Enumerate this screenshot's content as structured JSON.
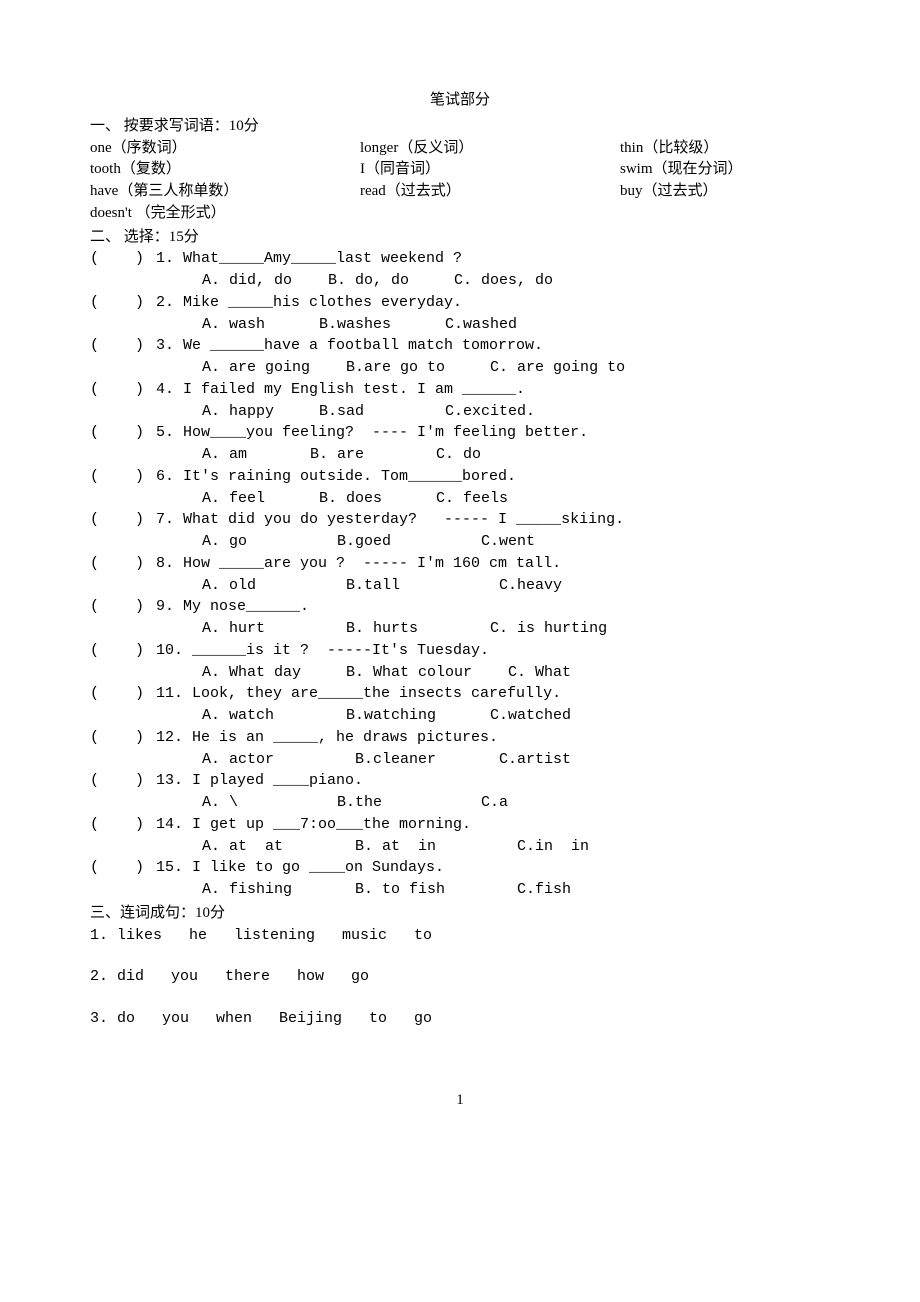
{
  "title": "笔试部分",
  "s1_heading": "一、 按要求写词语：10分",
  "s1r1c1": "one（序数词）",
  "s1r1c2": "longer（反义词）",
  "s1r1c3": "thin（比较级）",
  "s1r2c1": "tooth（复数）",
  "s1r2c2": "I（同音词）",
  "s1r2c3": "swim（现在分词）",
  "s1r3c1": "have（第三人称单数）",
  "s1r3c2": "read（过去式）",
  "s1r3c3": "buy（过去式）",
  "s1r4c1": "doesn't （完全形式）",
  "s2_heading": "二、 选择：15分",
  "paren": "(    )",
  "q1": "1. What_____Amy_____last weekend ?",
  "c1": "A. did, do    B. do, do     C. does, do",
  "q2": "2. Mike _____his clothes everyday.",
  "c2": "A. wash      B.washes      C.washed",
  "q3": "3. We ______have a football match tomorrow.",
  "c3": "A. are going    B.are go to     C. are going to",
  "q4": "4. I failed my English test. I am ______.",
  "c4": "A. happy     B.sad         C.excited.",
  "q5": "5. How____you feeling?  ---- I'm feeling better.",
  "c5": "A. am       B. are        C. do",
  "q6": "6. It's raining outside. Tom______bored.",
  "c6": "A. feel      B. does      C. feels",
  "q7": "7. What did you do yesterday?   ----- I _____skiing.",
  "c7": "A. go          B.goed          C.went",
  "q8": "8. How _____are you ?  ----- I'm 160 cm tall.",
  "c8": "A. old          B.tall           C.heavy",
  "q9": "9. My nose______.",
  "c9": "A. hurt         B. hurts        C. is hurting",
  "q10": "10. ______is it ?  -----It's Tuesday.",
  "c10": "A. What day     B. What colour    C. What",
  "q11": "11. Look, they are_____the insects carefully.",
  "c11": "A. watch        B.watching      C.watched",
  "q12": "12. He is an _____, he draws pictures.",
  "c12": "A. actor         B.cleaner       C.artist",
  "q13": "13. I played ____piano.",
  "c13": "A. \\           B.the           C.a",
  "q14": "14. I get up ___7:oo___the morning.",
  "c14": "A. at  at        B. at  in         C.in  in",
  "q15": "15. I like to go ____on Sundays.",
  "c15": "A. fishing       B. to fish        C.fish",
  "s3_heading": "三、连词成句：10分",
  "s3q1": "1. likes   he   listening   music   to",
  "s3q2": "2. did   you   there   how   go",
  "s3q3": "3. do   you   when   Beijing   to   go",
  "pagenum": "1"
}
